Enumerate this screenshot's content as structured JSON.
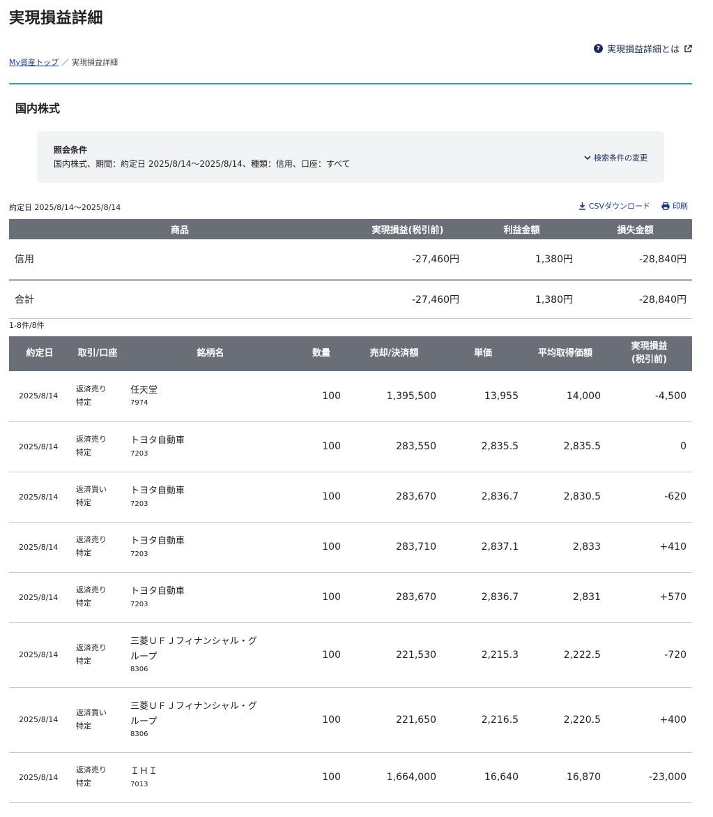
{
  "header": {
    "title": "実現損益詳細",
    "help_label": "実現損益詳細とは",
    "breadcrumb": {
      "home": "My資産トップ",
      "separator": "／",
      "current": "実現損益詳細"
    }
  },
  "section": {
    "title": "国内株式"
  },
  "conditions": {
    "label": "照会条件",
    "text": "国内株式、期間：約定日 2025/8/14〜2025/8/14、種類：信用、口座：すべて",
    "change_label": "検索条件の変更"
  },
  "period": "約定日 2025/8/14〜2025/8/14",
  "actions": {
    "csv": "CSVダウンロード",
    "print": "印刷"
  },
  "summary": {
    "headers": [
      "商品",
      "実現損益(税引前)",
      "利益金額",
      "損失金額"
    ],
    "rows": [
      {
        "product": "信用",
        "realized": "-27,460円",
        "profit": "1,380円",
        "loss": "-28,840円"
      }
    ],
    "total": {
      "label": "合計",
      "realized": "-27,460円",
      "profit": "1,380円",
      "loss": "-28,840円"
    }
  },
  "count": "1-8件/8件",
  "detail": {
    "headers": [
      "約定日",
      "取引/口座",
      "銘柄名",
      "数量",
      "売却/決済額",
      "単価",
      "平均取得価額",
      "実現損益",
      "(税引前)"
    ],
    "rows": [
      {
        "date": "2025/8/14",
        "trade": "返済売り",
        "account": "特定",
        "name": "任天堂",
        "code": "7974",
        "qty": "100",
        "amount": "1,395,500",
        "price": "13,955",
        "avg": "14,000",
        "pl": "-4,500",
        "sign": "neg"
      },
      {
        "date": "2025/8/14",
        "trade": "返済売り",
        "account": "特定",
        "name": "トヨタ自動車",
        "code": "7203",
        "qty": "100",
        "amount": "283,550",
        "price": "2,835.5",
        "avg": "2,835.5",
        "pl": "0",
        "sign": "zero"
      },
      {
        "date": "2025/8/14",
        "trade": "返済買い",
        "account": "特定",
        "name": "トヨタ自動車",
        "code": "7203",
        "qty": "100",
        "amount": "283,670",
        "price": "2,836.7",
        "avg": "2,830.5",
        "pl": "-620",
        "sign": "neg"
      },
      {
        "date": "2025/8/14",
        "trade": "返済売り",
        "account": "特定",
        "name": "トヨタ自動車",
        "code": "7203",
        "qty": "100",
        "amount": "283,710",
        "price": "2,837.1",
        "avg": "2,833",
        "pl": "+410",
        "sign": "pos"
      },
      {
        "date": "2025/8/14",
        "trade": "返済売り",
        "account": "特定",
        "name": "トヨタ自動車",
        "code": "7203",
        "qty": "100",
        "amount": "283,670",
        "price": "2,836.7",
        "avg": "2,831",
        "pl": "+570",
        "sign": "pos"
      },
      {
        "date": "2025/8/14",
        "trade": "返済売り",
        "account": "特定",
        "name1": "三菱ＵＦＪフィナンシャル・グ",
        "name2": "ループ",
        "code": "8306",
        "qty": "100",
        "amount": "221,530",
        "price": "2,215.3",
        "avg": "2,222.5",
        "pl": "-720",
        "sign": "neg"
      },
      {
        "date": "2025/8/14",
        "trade": "返済買い",
        "account": "特定",
        "name1": "三菱ＵＦＪフィナンシャル・グ",
        "name2": "ループ",
        "code": "8306",
        "qty": "100",
        "amount": "221,650",
        "price": "2,216.5",
        "avg": "2,220.5",
        "pl": "+400",
        "sign": "pos"
      },
      {
        "date": "2025/8/14",
        "trade": "返済売り",
        "account": "特定",
        "name": "ＩＨＩ",
        "code": "7013",
        "qty": "100",
        "amount": "1,664,000",
        "price": "16,640",
        "avg": "16,870",
        "pl": "-23,000",
        "sign": "neg"
      }
    ]
  },
  "colors": {
    "accent_rule": "#3a9ad0",
    "header_bg": "#6a6e77",
    "negative": "#1f8a80",
    "positive": "#c8225a"
  }
}
